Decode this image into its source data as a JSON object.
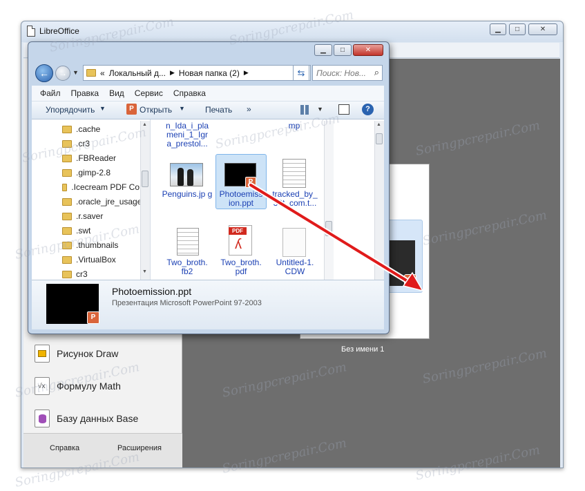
{
  "libreoffice": {
    "title": "LibreOffice",
    "create_items": [
      {
        "label": "Рисунок Draw",
        "icon": "draw-icon",
        "color": "#e0a800"
      },
      {
        "label": "Формулу Math",
        "icon": "math-icon",
        "color": "#777777"
      },
      {
        "label": "Базу данных Base",
        "icon": "base-icon",
        "color": "#8a2e9c"
      }
    ],
    "footer": {
      "help_label": "Справка",
      "extensions_label": "Расширения"
    },
    "recent_doc_label": "Без имени 1"
  },
  "explorer": {
    "breadcrumb": [
      "«",
      "Локальный д...",
      "Новая папка (2)"
    ],
    "search_placeholder": "Поиск: Нов...",
    "menu": [
      "Файл",
      "Правка",
      "Вид",
      "Сервис",
      "Справка"
    ],
    "toolbar": {
      "organize": "Упорядочить",
      "open": "Открыть",
      "print": "Печать",
      "more": "»"
    },
    "folders": [
      ".cache",
      ".cr3",
      ".FBReader",
      ".gimp-2.8",
      ".Icecream PDF Co",
      ".oracle_jre_usage",
      ".r.saver",
      ".swt",
      ".thumbnails",
      ".VirtualBox",
      "cr3"
    ],
    "files_top_partial": {
      "left": "n_Ida_i_pla meni_1_Igr a_prestol...",
      "right": "mp"
    },
    "files": [
      {
        "name": "Penguins.jp g",
        "kind": "image"
      },
      {
        "name": "Photoemiss ion.ppt",
        "kind": "ppt",
        "selected": true
      },
      {
        "name": "tracked_by_ 33t_com.t...",
        "kind": "doc"
      },
      {
        "name": "Two_broth. fb2",
        "kind": "doc"
      },
      {
        "name": "Two_broth. pdf",
        "kind": "pdf"
      },
      {
        "name": "Untitled-1. CDW",
        "kind": "blank"
      }
    ],
    "details": {
      "filename": "Photoemission.ppt",
      "type": "Презентация Microsoft PowerPoint 97-2003"
    }
  },
  "watermark": "Soringpcrepair.Com",
  "colors": {
    "accent": "#1a3fb3",
    "arrow": "#e01b1b",
    "pdf": "#d12a1f",
    "ppt": "#d9643a"
  }
}
